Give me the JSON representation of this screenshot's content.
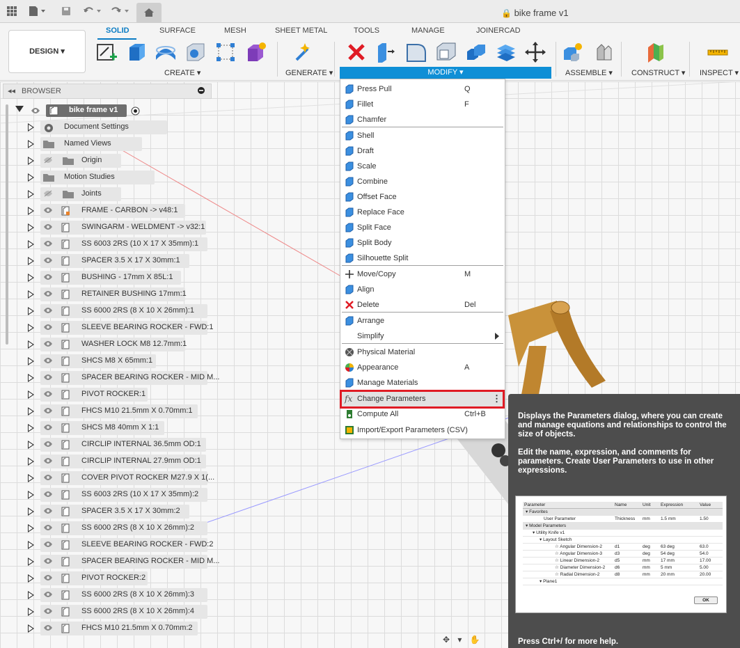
{
  "app": {
    "doc_title": "bike frame v1"
  },
  "tabs": [
    "SOLID",
    "SURFACE",
    "MESH",
    "SHEET METAL",
    "TOOLS",
    "MANAGE",
    "JOINERCAD"
  ],
  "design_label": "DESIGN",
  "groups": {
    "create": "CREATE",
    "generate": "GENERATE",
    "modify": "MODIFY",
    "assemble": "ASSEMBLE",
    "construct": "CONSTRUCT",
    "inspect": "INSPECT"
  },
  "browser": {
    "title": "BROWSER",
    "root": "bike frame v1",
    "folders": [
      "Document Settings",
      "Named Views",
      "Origin",
      "Motion Studies",
      "Joints"
    ],
    "components": [
      "FRAME - CARBON -> v48:1",
      "SWINGARM - WELDMENT -> v32:1",
      "SS 6003 2RS (10 X 17 X 35mm):1",
      "SPACER 3.5 X 17 X 30mm:1",
      "BUSHING - 17mm X 85L:1",
      "RETAINER BUSHING 17mm:1",
      "SS 6000 2RS (8 X 10 X 26mm):1",
      "SLEEVE BEARING ROCKER - FWD:1",
      "WASHER LOCK M8 12.7mm:1",
      "SHCS M8 X 65mm:1",
      "SPACER BEARING ROCKER - MID M...",
      "PIVOT ROCKER:1",
      "FHCS M10 21.5mm X 0.70mm:1",
      "SHCS M8 40mm X 1:1",
      "CIRCLIP INTERNAL 36.5mm OD:1",
      "CIRCLIP INTERNAL 27.9mm OD:1",
      "COVER PIVOT ROCKER M27.9 X 1(...",
      "SS 6003 2RS (10 X 17 X 35mm):2",
      "SPACER 3.5 X 17 X 30mm:2",
      "SS 6000 2RS (8 X 10 X 26mm):2",
      "SLEEVE BEARING ROCKER - FWD:2",
      "SPACER BEARING ROCKER - MID M...",
      "PIVOT ROCKER:2",
      "SS 6000 2RS (8 X 10 X 26mm):3",
      "SS 6000 2RS (8 X 10 X 26mm):4",
      "FHCS M10 21.5mm X 0.70mm:2"
    ]
  },
  "menu": [
    {
      "label": "Press Pull",
      "key": "Q"
    },
    {
      "label": "Fillet",
      "key": "F"
    },
    {
      "label": "Chamfer",
      "key": ""
    },
    {
      "label": "Shell",
      "key": ""
    },
    {
      "label": "Draft",
      "key": ""
    },
    {
      "label": "Scale",
      "key": ""
    },
    {
      "label": "Combine",
      "key": ""
    },
    {
      "label": "Offset Face",
      "key": ""
    },
    {
      "label": "Replace Face",
      "key": ""
    },
    {
      "label": "Split Face",
      "key": ""
    },
    {
      "label": "Split Body",
      "key": ""
    },
    {
      "label": "Silhouette Split",
      "key": ""
    },
    {
      "label": "Move/Copy",
      "key": "M"
    },
    {
      "label": "Align",
      "key": ""
    },
    {
      "label": "Delete",
      "key": "Del"
    },
    {
      "label": "Arrange",
      "key": ""
    },
    {
      "label": "Simplify",
      "key": ""
    },
    {
      "label": "Physical Material",
      "key": ""
    },
    {
      "label": "Appearance",
      "key": "A"
    },
    {
      "label": "Manage Materials",
      "key": ""
    },
    {
      "label": "Change Parameters",
      "key": ""
    },
    {
      "label": "Compute All",
      "key": "Ctrl+B"
    },
    {
      "label": "Import/Export Parameters (CSV)",
      "key": ""
    }
  ],
  "tooltip": {
    "p1": "Displays the Parameters dialog, where you can create and manage equations and relationships to control the size of objects.",
    "p2": "Edit the name, expression, and comments for parameters. Create User Parameters to use in other expressions.",
    "help": "Press Ctrl+/ for more help.",
    "table_headers": [
      "Parameter",
      "Name",
      "Unit",
      "Expression",
      "Value"
    ],
    "rows": [
      [
        "Favorites",
        "",
        "",
        "",
        ""
      ],
      [
        "User Parameter",
        "Thickness",
        "mm",
        "1.5 mm",
        "1.50"
      ],
      [
        "Model Parameters",
        "",
        "",
        "",
        ""
      ],
      [
        "Utility Knife v1",
        "",
        "",
        "",
        ""
      ],
      [
        "Layout Sketch",
        "",
        "",
        "",
        ""
      ],
      [
        "Angular Dimension-2",
        "d1",
        "deg",
        "63 deg",
        "63.0"
      ],
      [
        "Angular Dimension-3",
        "d3",
        "deg",
        "54 deg",
        "54.0"
      ],
      [
        "Linear Dimension-2",
        "d5",
        "mm",
        "17 mm",
        "17.00"
      ],
      [
        "Diameter Dimension-2",
        "d6",
        "mm",
        "5 mm",
        "5.00"
      ],
      [
        "Radial Dimension-2",
        "d8",
        "mm",
        "20 mm",
        "20.00"
      ],
      [
        "Plane1",
        "",
        "",
        "",
        ""
      ]
    ],
    "ok": "OK"
  },
  "colors": {
    "accent": "#0f8fd6",
    "highlight": "#e01b24",
    "tooltip_bg": "#4d4d4d"
  }
}
